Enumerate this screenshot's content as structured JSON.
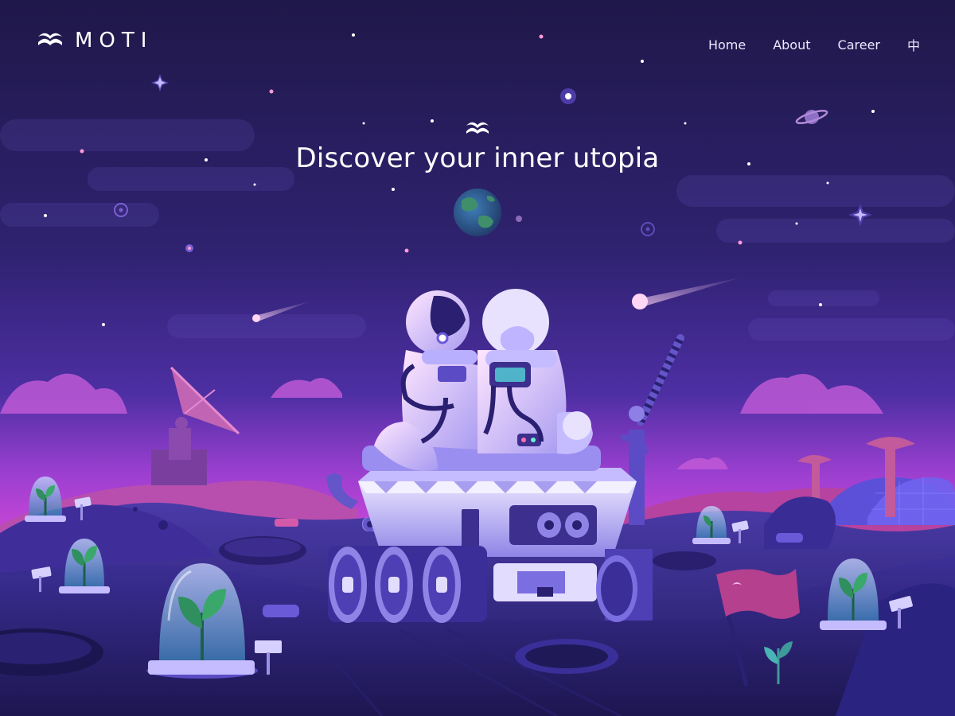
{
  "brand": {
    "name": "MOTI",
    "logo_icon": "open-book-wave-icon"
  },
  "nav": {
    "items": [
      {
        "label": "Home"
      },
      {
        "label": "About"
      },
      {
        "label": "Career"
      },
      {
        "label": "中"
      }
    ]
  },
  "hero": {
    "icon": "open-book-wave-icon",
    "title": "Discover your inner utopia"
  },
  "illustration": {
    "subject": "two astronauts sitting on a lunar rover on a purple planet surface",
    "elements": [
      "earth-planet",
      "ringed-planet",
      "shooting-star",
      "satellite-dish",
      "plant-domes",
      "crater",
      "flag",
      "robot-arm",
      "greenhouse-domes"
    ]
  },
  "colors": {
    "sky_top": "#1f1849",
    "sky_mid": "#3f2a8c",
    "horizon_glow": "#c23fd6",
    "ground_dark": "#2a2370",
    "ground_pink": "#a83fb0",
    "rover_body": "#d9d3ff",
    "text": "#ffffff"
  }
}
